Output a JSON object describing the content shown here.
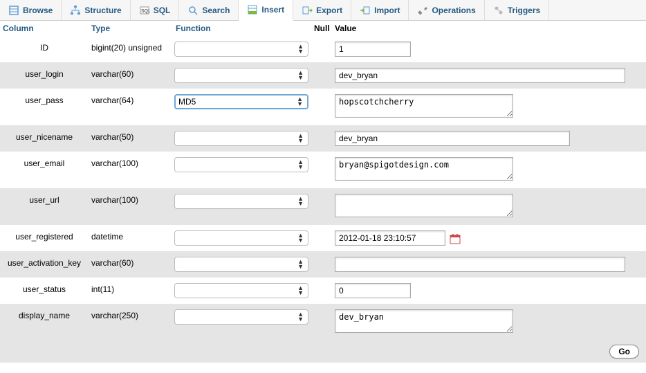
{
  "tabs": [
    {
      "label": "Browse",
      "icon": "browse-icon"
    },
    {
      "label": "Structure",
      "icon": "structure-icon"
    },
    {
      "label": "SQL",
      "icon": "sql-icon"
    },
    {
      "label": "Search",
      "icon": "search-icon"
    },
    {
      "label": "Insert",
      "icon": "insert-icon",
      "active": true
    },
    {
      "label": "Export",
      "icon": "export-icon"
    },
    {
      "label": "Import",
      "icon": "import-icon"
    },
    {
      "label": "Operations",
      "icon": "operations-icon"
    },
    {
      "label": "Triggers",
      "icon": "triggers-icon"
    }
  ],
  "headers": {
    "column": "Column",
    "type": "Type",
    "function": "Function",
    "null": "Null",
    "value": "Value"
  },
  "rows": [
    {
      "column": "ID",
      "type": "bigint(20) unsigned",
      "function": "",
      "value": "1",
      "input": "text-short",
      "alt": false
    },
    {
      "column": "user_login",
      "type": "varchar(60)",
      "function": "",
      "value": "dev_bryan",
      "input": "text-long",
      "alt": true
    },
    {
      "column": "user_pass",
      "type": "varchar(64)",
      "function": "MD5",
      "value": "hopscotchcherry",
      "input": "textarea",
      "alt": false,
      "func_focused": true
    },
    {
      "column": "user_nicename",
      "type": "varchar(50)",
      "function": "",
      "value": "dev_bryan",
      "input": "text-med",
      "alt": true
    },
    {
      "column": "user_email",
      "type": "varchar(100)",
      "function": "",
      "value": "bryan@spigotdesign.com",
      "input": "textarea",
      "alt": false
    },
    {
      "column": "user_url",
      "type": "varchar(100)",
      "function": "",
      "value": "",
      "input": "textarea",
      "alt": true
    },
    {
      "column": "user_registered",
      "type": "datetime",
      "function": "",
      "value": "2012-01-18 23:10:57",
      "input": "text-date",
      "alt": false,
      "has_calendar": true
    },
    {
      "column": "user_activation_key",
      "type": "varchar(60)",
      "function": "",
      "value": "",
      "input": "text-long",
      "alt": true
    },
    {
      "column": "user_status",
      "type": "int(11)",
      "function": "",
      "value": "0",
      "input": "text-short",
      "alt": false
    },
    {
      "column": "display_name",
      "type": "varchar(250)",
      "function": "",
      "value": "dev_bryan",
      "input": "textarea",
      "alt": true
    }
  ],
  "footer": {
    "go": "Go"
  }
}
